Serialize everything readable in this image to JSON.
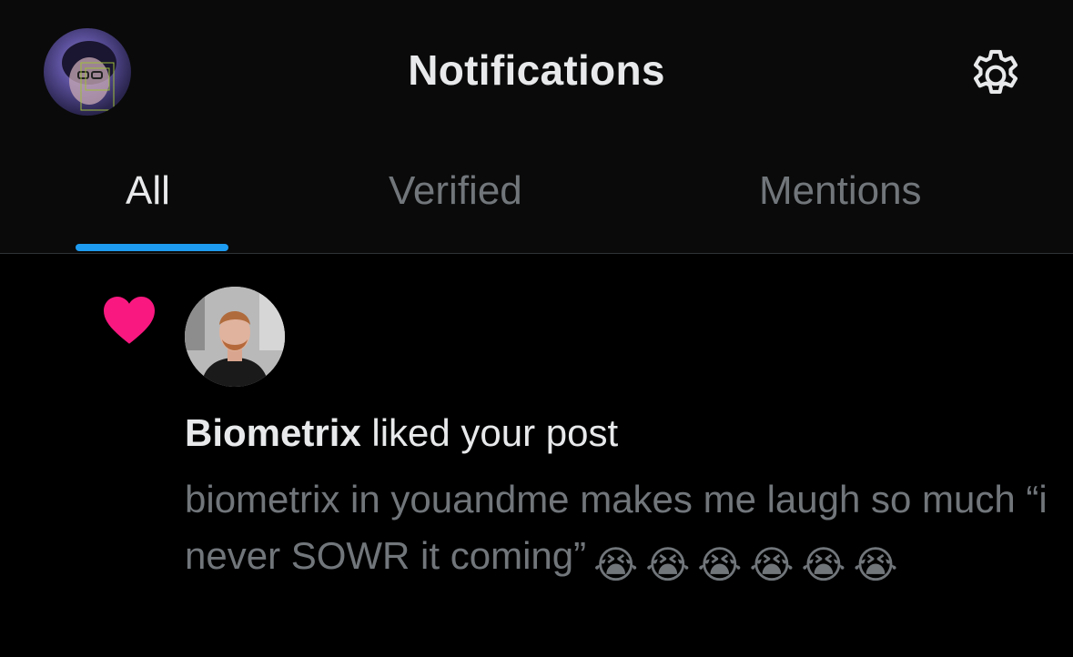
{
  "header": {
    "title": "Notifications",
    "settings_icon": "gear-icon"
  },
  "tabs": [
    {
      "label": "All",
      "active": true
    },
    {
      "label": "Verified",
      "active": false
    },
    {
      "label": "Mentions",
      "active": false
    }
  ],
  "notification": {
    "type_icon": "heart-icon",
    "user_name": "Biometrix",
    "action": " liked your post",
    "post_text": "biometrix in youandme makes me laugh so much “i never SOWR it coming”",
    "emoji": [
      "😭",
      "😭",
      "😭",
      "😭",
      "😭",
      "😭"
    ]
  },
  "colors": {
    "accent": "#1d9bf0",
    "like": "#f91880",
    "text_primary": "#e7e9ea",
    "text_secondary": "#71767b",
    "background": "#000000"
  }
}
